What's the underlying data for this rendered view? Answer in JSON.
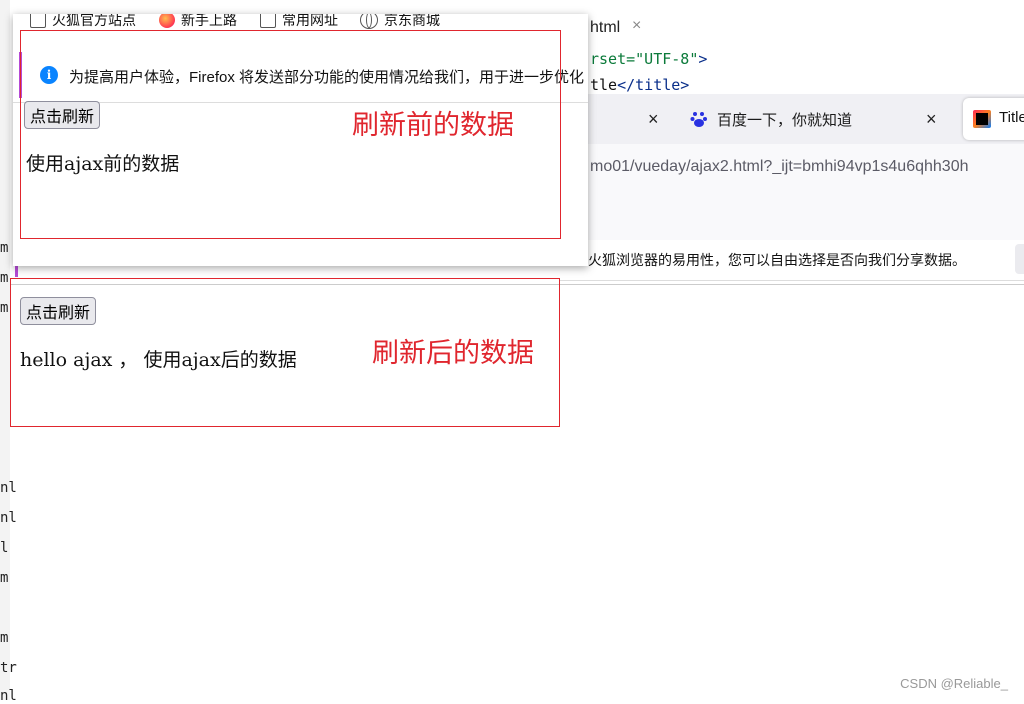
{
  "editor": {
    "tab_label": "html",
    "tab_close": "×",
    "code_lines": [
      {
        "pre": "rset=",
        "str": "\"UTF-8\"",
        "post": ">"
      },
      {
        "pre": "tle",
        "tag": "</title>",
        "post": ""
      }
    ],
    "gutter_chars": [
      "m",
      "m",
      "m",
      "nl",
      "nl",
      "l",
      "m",
      "m",
      "tr",
      "nl"
    ]
  },
  "browser": {
    "tabs": [
      {
        "label": "",
        "close": "×"
      },
      {
        "label": "百度一下，你就知道",
        "close": "×"
      },
      {
        "label": "Title"
      }
    ],
    "url": "mo01/vueday/ajax2.html?_ijt=bmhi94vp1s4u6qhh30h",
    "notice_text": "火狐浏览器的易用性，您可以自由选择是否向我们分享数据。"
  },
  "popup": {
    "bookmarks": [
      {
        "icon": "checkbox-icon",
        "label": "火狐官方站点"
      },
      {
        "icon": "firefox-icon",
        "label": "新手上路"
      },
      {
        "icon": "checkbox-icon",
        "label": "常用网址"
      },
      {
        "icon": "globe-icon",
        "label": "京东商城"
      }
    ],
    "notice_text": "为提高用户体验，Firefox 将发送部分功能的使用情况给我们，用于进一步优化",
    "info_glyph": "i"
  },
  "before": {
    "button_label": "点击刷新",
    "content_text": "使用ajax前的数据",
    "caption": "刷新前的数据"
  },
  "after": {
    "button_label": "点击刷新",
    "content_text": "hello ajax ， 使用ajax后的数据",
    "caption": "刷新后的数据"
  },
  "watermark": "CSDN @Reliable_",
  "colors": {
    "annotation": "#e0262e",
    "accent": "#b54bd6",
    "info": "#0a84ff"
  }
}
